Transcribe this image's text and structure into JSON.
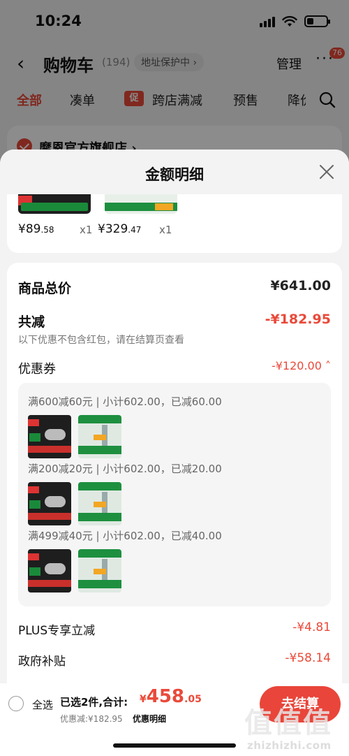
{
  "status_bar": {
    "time": "10:24"
  },
  "nav": {
    "title": "购物车",
    "count": "(194)",
    "address": "地址保护中 ›",
    "manage": "管理",
    "more": "···",
    "badge": "76",
    "back": "‹"
  },
  "tabs": [
    {
      "label": "全部",
      "active": true
    },
    {
      "label": "凑单"
    },
    {
      "label": "跨店满减",
      "tag": "促"
    },
    {
      "label": "预售"
    },
    {
      "label": "降价"
    }
  ],
  "store": {
    "name": "摩恩官方旗舰店 ›"
  },
  "sheet": {
    "title": "金额明细"
  },
  "products": [
    {
      "price_int": "¥89",
      "price_dec": ".58",
      "qty": "x1"
    },
    {
      "price_int": "¥329",
      "price_dec": ".47",
      "qty": "x1"
    }
  ],
  "summary": {
    "total_label": "商品总价",
    "total_value": "¥641.00",
    "reduce_label": "共减",
    "reduce_value": "-¥182.95",
    "reduce_note": "以下优惠不包含红包，请在结算页查看",
    "coupon_label": "优惠券",
    "coupon_value": "-¥120.00 ˄",
    "coupons": [
      {
        "line": "满600减60元 | 小计602.00，已减60.00"
      },
      {
        "line": "满200减20元 | 小计602.00，已减20.00"
      },
      {
        "line": "满499减40元 | 小计602.00，已减40.00"
      }
    ],
    "plus_label": "PLUS专享立减",
    "plus_value": "-¥4.81",
    "gov_label": "政府补贴",
    "gov_value": "-¥58.14"
  },
  "bottom": {
    "select_all": "全选",
    "selected": "已选2件,合计:",
    "total_yen": "¥",
    "total_int": "458",
    "total_dec": ".05",
    "discount": "优惠减:¥182.95",
    "detail_link": "优惠明细",
    "checkout": "去结算"
  },
  "watermark": {
    "logo": "值值值",
    "text": "zhizhizhi.com"
  },
  "colors": {
    "accent": "#e94a3a"
  }
}
